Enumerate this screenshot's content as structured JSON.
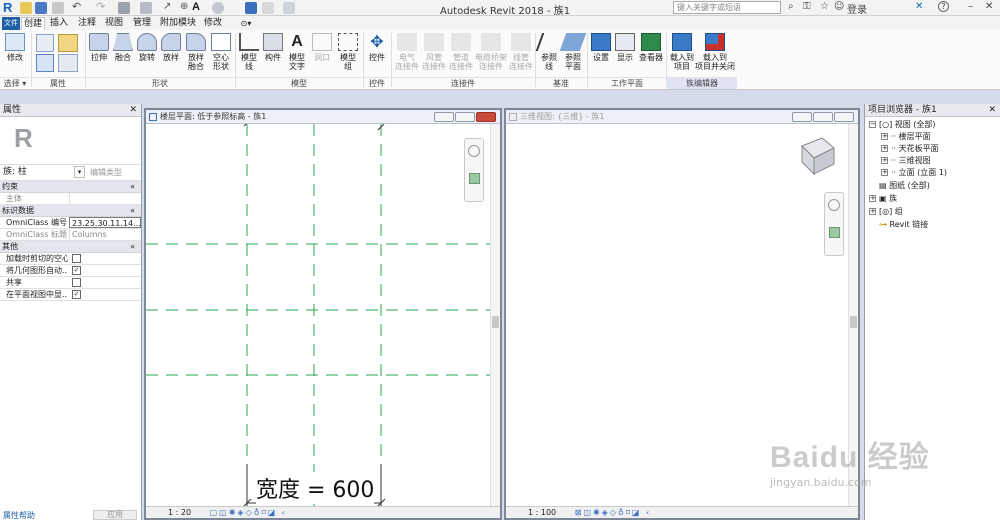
{
  "app": {
    "logo": "R",
    "title": "Autodesk Revit 2018 -  族1",
    "search_placeholder": "键入关键字或短语",
    "login_label": "登录",
    "help_label": "?"
  },
  "tabs": [
    "文件",
    "创建",
    "插入",
    "注释",
    "视图",
    "管理",
    "附加模块",
    "修改"
  ],
  "ribbon": {
    "select": {
      "modify": "修改",
      "select": "选择 ▾"
    },
    "properties_group": "属性",
    "form": {
      "extrude": "拉伸",
      "blend": "融合",
      "revolve": "旋转",
      "sweep": "放样",
      "swept_blend": "放样\n融合",
      "void": "空心\n形状",
      "group": "形状"
    },
    "model": {
      "model_line": "模型\n线",
      "component": "构件",
      "model_text": "模型\n文字",
      "opening": "洞口",
      "model_group": "模型\n组",
      "group": "模型"
    },
    "control": {
      "control": "控件",
      "group": "控件"
    },
    "connectors": {
      "electrical": "电气\n连接件",
      "duct": "风管\n连接件",
      "pipe": "管道\n连接件",
      "cable_tray": "电缆桥架\n连接件",
      "conduit": "线管\n连接件",
      "group": "连接件"
    },
    "datum": {
      "ref_line": "参照\n线",
      "ref_plane": "参照\n平面",
      "group": "基准"
    },
    "work_plane": {
      "set": "设置",
      "show": "显示",
      "viewer": "查看器",
      "group": "工作平面"
    },
    "family_editor": {
      "load_project": "载入到\n项目",
      "load_close": "载入到\n项目并关闭",
      "group": "族编辑器"
    }
  },
  "properties": {
    "title": "属性",
    "family": "族: 柱",
    "edit_type": "编辑类型",
    "sections": [
      {
        "name": "约束",
        "rows": [
          {
            "label": "主体",
            "value": ""
          }
        ]
      },
      {
        "name": "标识数据",
        "rows": [
          {
            "label": "OmniClass 编号",
            "value": "23.25.30.11.14..."
          },
          {
            "label": "OmniClass 标题",
            "value": "Columns"
          }
        ]
      },
      {
        "name": "其他",
        "rows": [
          {
            "label": "加载时剪切的空心",
            "checked": false
          },
          {
            "label": "将几何图形自动...",
            "checked": true
          },
          {
            "label": "共享",
            "checked": false
          },
          {
            "label": "在平面视图中显...",
            "checked": true
          }
        ]
      }
    ],
    "help": "属性帮助",
    "apply": "应用"
  },
  "views": {
    "plan": {
      "title": "楼层平面: 低于参照标高 - 族1",
      "scale": "1 : 20",
      "dimension": "宽度 = 600"
    },
    "three_d": {
      "title": "三维视图: {三维} - 族1",
      "scale": "1 : 100"
    }
  },
  "browser": {
    "title": "项目浏览器 - 族1",
    "items": [
      {
        "label": "视图 (全部)",
        "level": 0,
        "exp": "−"
      },
      {
        "label": "楼层平面",
        "level": 1,
        "exp": "+"
      },
      {
        "label": "天花板平面",
        "level": 1,
        "exp": "+"
      },
      {
        "label": "三维视图",
        "level": 1,
        "exp": "+"
      },
      {
        "label": "立面 (立面 1)",
        "level": 1,
        "exp": "+"
      },
      {
        "label": "图纸 (全部)",
        "level": 0,
        "exp": ""
      },
      {
        "label": "族",
        "level": 0,
        "exp": "+"
      },
      {
        "label": "组",
        "level": 0,
        "exp": "+"
      },
      {
        "label": "Revit 链接",
        "level": 0,
        "exp": ""
      }
    ]
  },
  "watermark": {
    "main": "Baidu 经验",
    "sub": "jingyan.baidu.com"
  },
  "colors": {
    "accent": "#1e5fa8",
    "grid_line": "#2aa84a",
    "panel_border": "#7d8798"
  }
}
